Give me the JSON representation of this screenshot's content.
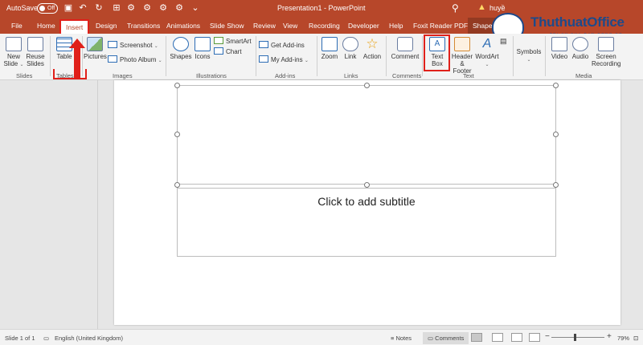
{
  "titlebar": {
    "autosave_label": "AutoSave",
    "autosave_state": "Off",
    "document_title": "Presentation1  -  PowerPoint",
    "user_name": "huyề"
  },
  "tabs": [
    "File",
    "Home",
    "Insert",
    "Design",
    "Transitions",
    "Animations",
    "Slide Show",
    "Review",
    "View",
    "Recording",
    "Developer",
    "Help",
    "Foxit Reader PDF",
    "Shape Format"
  ],
  "active_tab": "Insert",
  "logo": {
    "name": "ThuthuatOffice",
    "tagline": "TRI KY CUA DAN CONG SO"
  },
  "ribbon": {
    "slides": {
      "new_slide": "New Slide",
      "reuse_slides": "Reuse Slides",
      "label": "Slides"
    },
    "tables": {
      "table": "Table",
      "label": "Tables"
    },
    "images": {
      "pictures": "Pictures",
      "screenshot": "Screenshot",
      "photo_album": "Photo Album",
      "label": "Images"
    },
    "illustrations": {
      "shapes": "Shapes",
      "icons": "Icons",
      "smartart": "SmartArt",
      "chart": "Chart",
      "label": "Illustrations"
    },
    "addins": {
      "get_addins": "Get Add-ins",
      "my_addins": "My Add-ins",
      "label": "Add-ins"
    },
    "links": {
      "zoom": "Zoom",
      "link": "Link",
      "action": "Action",
      "label": "Links"
    },
    "comments": {
      "comment": "Comment",
      "label": "Comments"
    },
    "text": {
      "text_box_1": "Text",
      "text_box_2": "Box",
      "header_footer_1": "Header",
      "header_footer_2": "& Footer",
      "wordart": "WordArt",
      "label": "Text"
    },
    "symbols": {
      "symbols": "Symbols"
    },
    "media": {
      "video": "Video",
      "audio": "Audio",
      "screen_recording_1": "Screen",
      "screen_recording_2": "Recording",
      "label": "Media"
    }
  },
  "slide": {
    "subtitle_placeholder": "Click to add subtitle"
  },
  "statusbar": {
    "slide_info": "Slide 1 of 1",
    "language": "English (United Kingdom)",
    "notes": "Notes",
    "comments": "Comments",
    "zoom": "79%"
  },
  "colors": {
    "accent": "#b7472a",
    "highlight": "#e0201a",
    "logo": "#1e4a8a"
  },
  "icons": [
    "search-icon",
    "warning-icon",
    "save-icon",
    "undo-icon",
    "redo-icon"
  ]
}
